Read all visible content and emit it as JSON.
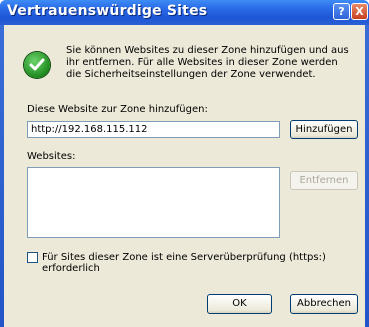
{
  "window": {
    "title": "Vertrauenswürdige Sites",
    "help_button": "?",
    "close_button": "X"
  },
  "info": {
    "icon": "checkmark-icon",
    "text": "Sie können Websites zu dieser Zone hinzufügen und aus ihr entfernen. Für alle Websites in dieser Zone werden die Sicherheitseinstellungen der Zone verwendet."
  },
  "add_site": {
    "label": "Diese Website zur Zone hinzufügen:",
    "value": "http://192.168.115.112",
    "add_button": "Hinzufügen"
  },
  "websites": {
    "label": "Websites:",
    "items": [],
    "remove_button": "Entfernen"
  },
  "https_check": {
    "checked": false,
    "label": "Für Sites dieser Zone ist eine Serverüberprüfung (https:) erforderlich"
  },
  "footer": {
    "ok": "OK",
    "cancel": "Abbrechen"
  }
}
